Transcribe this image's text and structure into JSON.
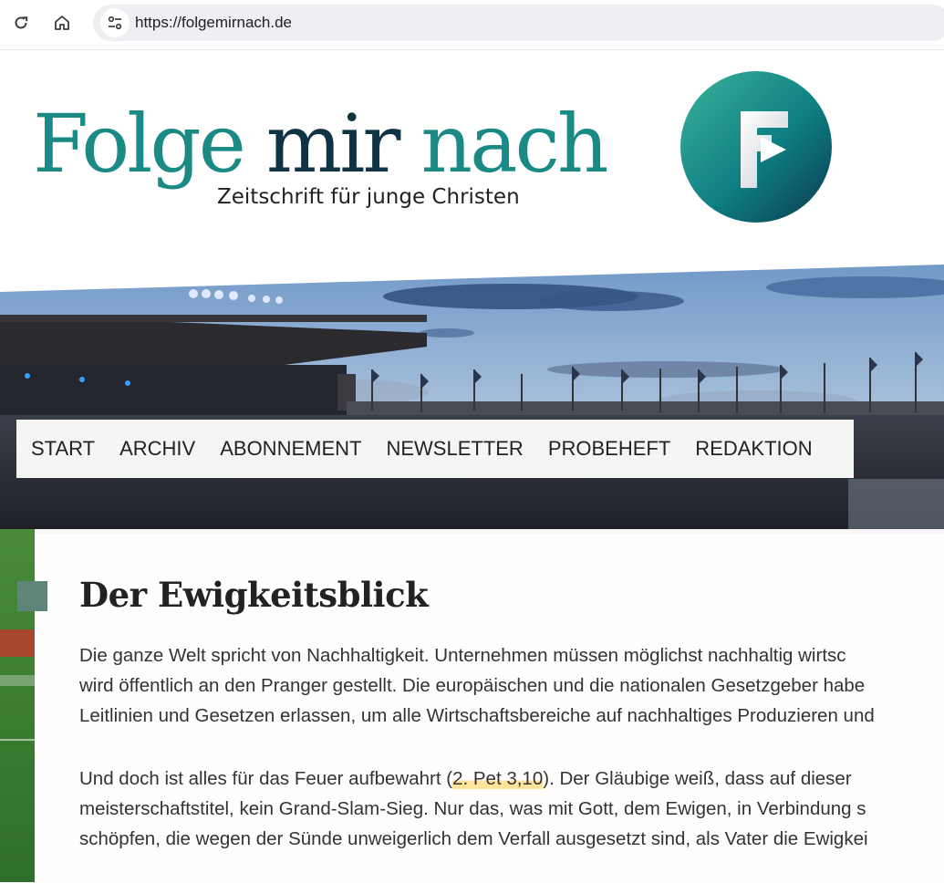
{
  "browser": {
    "url": "https://folgemirnach.de",
    "icons": [
      "reload-icon",
      "home-icon",
      "site-settings-icon"
    ]
  },
  "site": {
    "logo_word1": "Folge",
    "logo_word2": "mir",
    "logo_word3": "nach",
    "tagline": "Zeitschrift für junge Christen",
    "colors": {
      "teal": "#1b8a85",
      "dark": "#0e3344",
      "accent_square": "#5f857b",
      "highlight": "#ffe39a"
    }
  },
  "nav": {
    "items": [
      "START",
      "ARCHIV",
      "ABONNEMENT",
      "NEWSLETTER",
      "PROBEHEFT",
      "REDAKTION"
    ]
  },
  "article": {
    "title": "Der Ewigkeitsblick",
    "p1": [
      "Die ganze Welt spricht von Nachhaltigkeit. Unternehmen müssen möglichst nachhaltig wirtsc",
      "wird öffentlich an den Pranger gestellt. Die europäischen und die nationalen Gesetzgeber habe",
      "Leitlinien und Gesetzen erlassen, um alle Wirtschaftsbereiche auf nachhaltiges Produzieren und"
    ],
    "p2_line1_before": "Und doch ist alles für das Feuer aufbewahrt (",
    "p2_ref": "2. Pet 3,10",
    "p2_line1_after": "). Der Gläubige weiß, dass auf dieser",
    "p2_rest": [
      "meisterschaftstitel, kein Grand-Slam-Sieg. Nur das, was mit Gott, dem Ewigen, in Verbindung s",
      "schöpfen, die wegen der Sünde unweigerlich dem Verfall ausgesetzt sind, als Vater die Ewigkei"
    ]
  }
}
